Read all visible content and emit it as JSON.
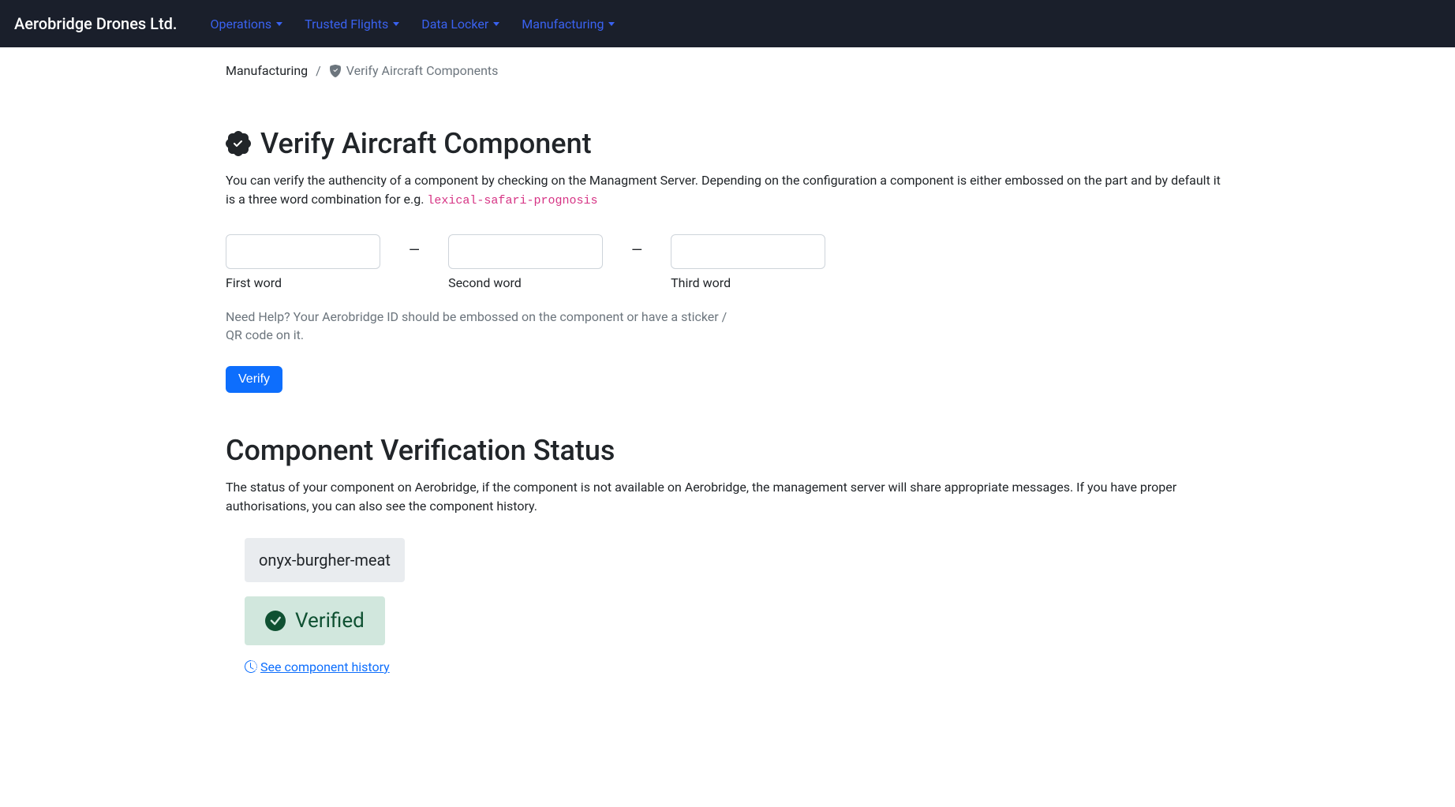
{
  "navbar": {
    "brand": "Aerobridge Drones Ltd.",
    "items": [
      {
        "label": "Operations"
      },
      {
        "label": "Trusted Flights"
      },
      {
        "label": "Data Locker"
      },
      {
        "label": "Manufacturing"
      }
    ]
  },
  "breadcrumb": {
    "root": "Manufacturing",
    "current": "Verify Aircraft Components"
  },
  "verify": {
    "title": "Verify Aircraft Component",
    "lead_pre": "You can verify the authencity of a component by checking on the Managment Server. Depending on the configuration a component is either embossed on the part and by default it is a three word combination for e.g. ",
    "lead_code": "lexical-safari-prognosis",
    "inputs": {
      "first_label": "First word",
      "second_label": "Second word",
      "third_label": "Third word",
      "dash": "—"
    },
    "help_text": "Need Help? Your Aerobridge ID should be embossed on the component or have a sticker / QR code on it.",
    "button": "Verify"
  },
  "status": {
    "title": "Component Verification Status",
    "lead": "The status of your component on Aerobridge, if the component is not available on Aerobridge, the management server will share appropriate messages. If you have proper authorisations, you can also see the component history.",
    "code": "onyx-burgher-meat",
    "verified_label": "Verified",
    "history_link": " See component history"
  }
}
